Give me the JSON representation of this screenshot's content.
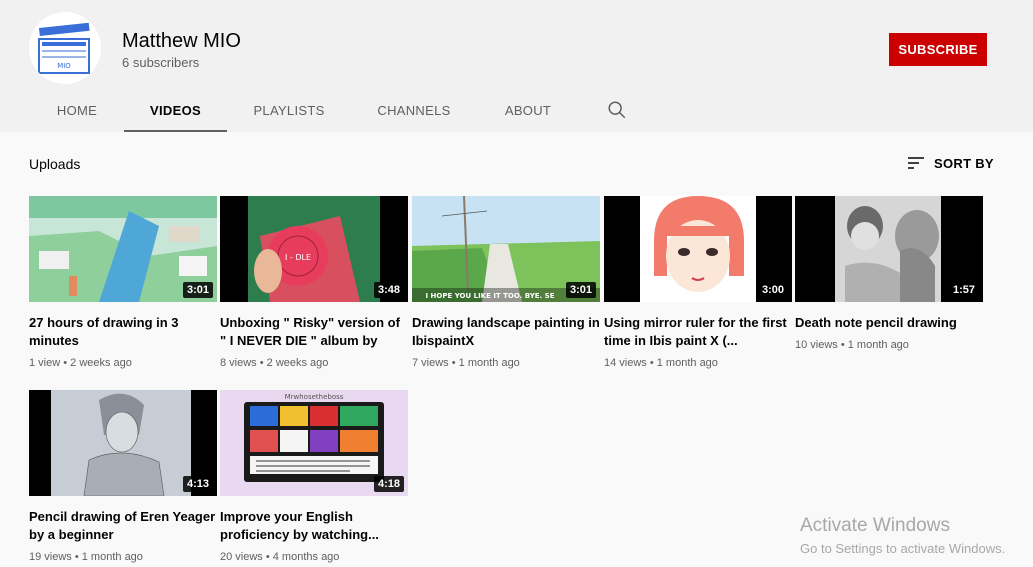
{
  "channel": {
    "name": "Matthew MIO",
    "subscribers": "6 subscribers",
    "subscribe_label": "SUBSCRIBE",
    "avatar_text": "MIO",
    "accent": "#cc0000"
  },
  "tabs": [
    {
      "label": "HOME",
      "active": false
    },
    {
      "label": "VIDEOS",
      "active": true
    },
    {
      "label": "PLAYLISTS",
      "active": false
    },
    {
      "label": "CHANNELS",
      "active": false
    },
    {
      "label": "ABOUT",
      "active": false
    }
  ],
  "search_icon": "search-icon",
  "section": {
    "title": "Uploads",
    "sort_label": "SORT BY",
    "sort_icon": "sort-icon"
  },
  "videos": [
    {
      "duration": "3:01",
      "title": "27 hours of drawing in 3 minutes",
      "meta": "1 view • 2 weeks ago"
    },
    {
      "duration": "3:48",
      "title": "Unboxing \" Risky\" version of \" I NEVER DIE \" album by (G)I-...",
      "meta": "8 views • 2 weeks ago",
      "thumb_text": "I - DLE"
    },
    {
      "duration": "3:01",
      "title": "Drawing landscape painting in IbispaintX",
      "meta": "7 views • 1 month ago",
      "thumb_text": "I HOPE YOU LIKE IT TOO. BYE. SE"
    },
    {
      "duration": "3:00",
      "title": "Using mirror ruler for the first time in Ibis paint X (...",
      "meta": "14 views • 1 month ago"
    },
    {
      "duration": "1:57",
      "title": "Death note pencil drawing",
      "meta": "10 views • 1 month ago"
    },
    {
      "duration": "4:13",
      "title": "Pencil drawing of Eren Yeager by a beginner",
      "meta": "19 views • 1 month ago"
    },
    {
      "duration": "4:18",
      "title": "Improve your English proficiency by watching...",
      "meta": "20 views • 4 months ago",
      "thumb_text": "Mrwhosetheboss"
    }
  ],
  "watermark": {
    "line1": "Activate Windows",
    "line2": "Go to Settings to activate Windows."
  }
}
